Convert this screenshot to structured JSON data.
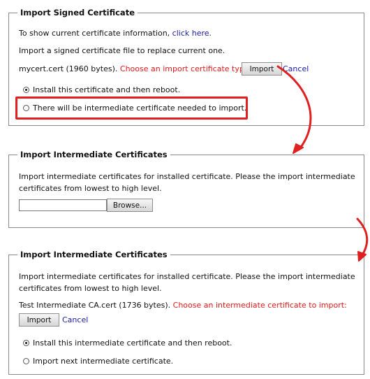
{
  "panel1": {
    "title": "Import Signed Certificate",
    "line1_prefix": "To show current certificate information,",
    "line1_link": "click here.",
    "line2": "Import a signed certificate file to replace current one.",
    "file_info": "mycert.cert (1960 bytes).",
    "prompt": "Choose an import certificate type:",
    "import_label": "Import",
    "cancel_label": "Cancel",
    "radio1_label": "Install this certificate and then reboot.",
    "radio1_checked": true,
    "radio2_label": "There will be intermediate certificate needed to import.",
    "radio2_checked": false
  },
  "panel2": {
    "title": "Import Intermediate Certificates",
    "desc1": "Import intermediate certificates for installed certificate. Please the import intermediate",
    "desc2": "certificates from lowest to high level.",
    "file_value": "",
    "browse_label": "Browse..."
  },
  "panel3": {
    "title": "Import Intermediate Certificates",
    "desc1": "Import intermediate certificates for installed certificate. Please the import intermediate",
    "desc2": "certificates from lowest to high level.",
    "file_info": "Test Intermediate CA.cert (1736 bytes).",
    "prompt": "Choose an intermediate certificate to import:",
    "import_label": "Import",
    "cancel_label": "Cancel",
    "radio1_label": "Install this intermediate certificate and then reboot.",
    "radio1_checked": true,
    "radio2_label": "Import next intermediate certificate.",
    "radio2_checked": false
  },
  "colors": {
    "highlight": "#e02020",
    "prompt_red": "#e01b1b",
    "link_blue": "#1a1aa6"
  }
}
